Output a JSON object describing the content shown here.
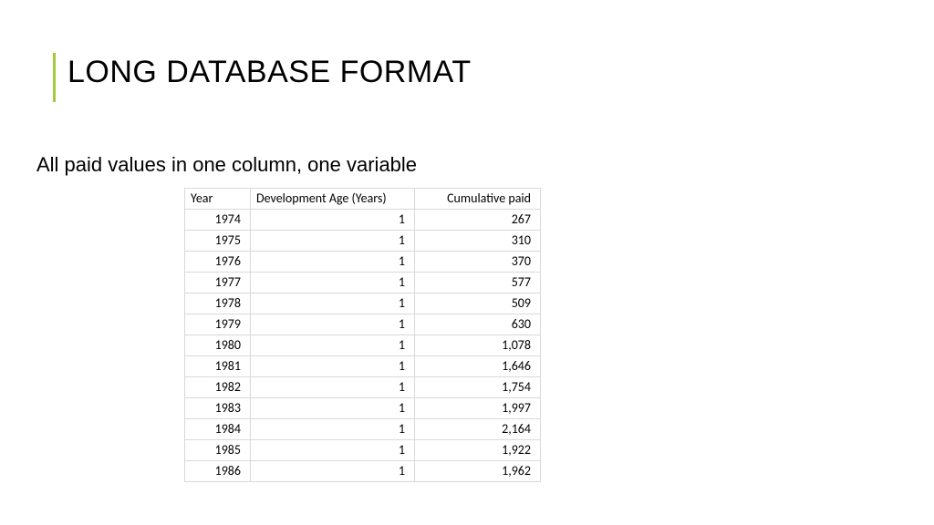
{
  "title": "LONG DATABASE FORMAT",
  "subtitle": "All paid values in one column, one variable",
  "table": {
    "headers": {
      "year": "Year",
      "dev": "Development Age (Years)",
      "cum": "Cumulative paid"
    },
    "rows": [
      {
        "year": "1974",
        "dev": "1",
        "cum": "267"
      },
      {
        "year": "1975",
        "dev": "1",
        "cum": "310"
      },
      {
        "year": "1976",
        "dev": "1",
        "cum": "370"
      },
      {
        "year": "1977",
        "dev": "1",
        "cum": "577"
      },
      {
        "year": "1978",
        "dev": "1",
        "cum": "509"
      },
      {
        "year": "1979",
        "dev": "1",
        "cum": "630"
      },
      {
        "year": "1980",
        "dev": "1",
        "cum": "1,078"
      },
      {
        "year": "1981",
        "dev": "1",
        "cum": "1,646"
      },
      {
        "year": "1982",
        "dev": "1",
        "cum": "1,754"
      },
      {
        "year": "1983",
        "dev": "1",
        "cum": "1,997"
      },
      {
        "year": "1984",
        "dev": "1",
        "cum": "2,164"
      },
      {
        "year": "1985",
        "dev": "1",
        "cum": "1,922"
      },
      {
        "year": "1986",
        "dev": "1",
        "cum": "1,962"
      }
    ]
  },
  "chart_data": {
    "type": "table",
    "title": "LONG DATABASE FORMAT",
    "columns": [
      "Year",
      "Development Age (Years)",
      "Cumulative paid"
    ],
    "rows": [
      [
        1974,
        1,
        267
      ],
      [
        1975,
        1,
        310
      ],
      [
        1976,
        1,
        370
      ],
      [
        1977,
        1,
        577
      ],
      [
        1978,
        1,
        509
      ],
      [
        1979,
        1,
        630
      ],
      [
        1980,
        1,
        1078
      ],
      [
        1981,
        1,
        1646
      ],
      [
        1982,
        1,
        1754
      ],
      [
        1983,
        1,
        1997
      ],
      [
        1984,
        1,
        2164
      ],
      [
        1985,
        1,
        1922
      ],
      [
        1986,
        1,
        1962
      ]
    ]
  }
}
